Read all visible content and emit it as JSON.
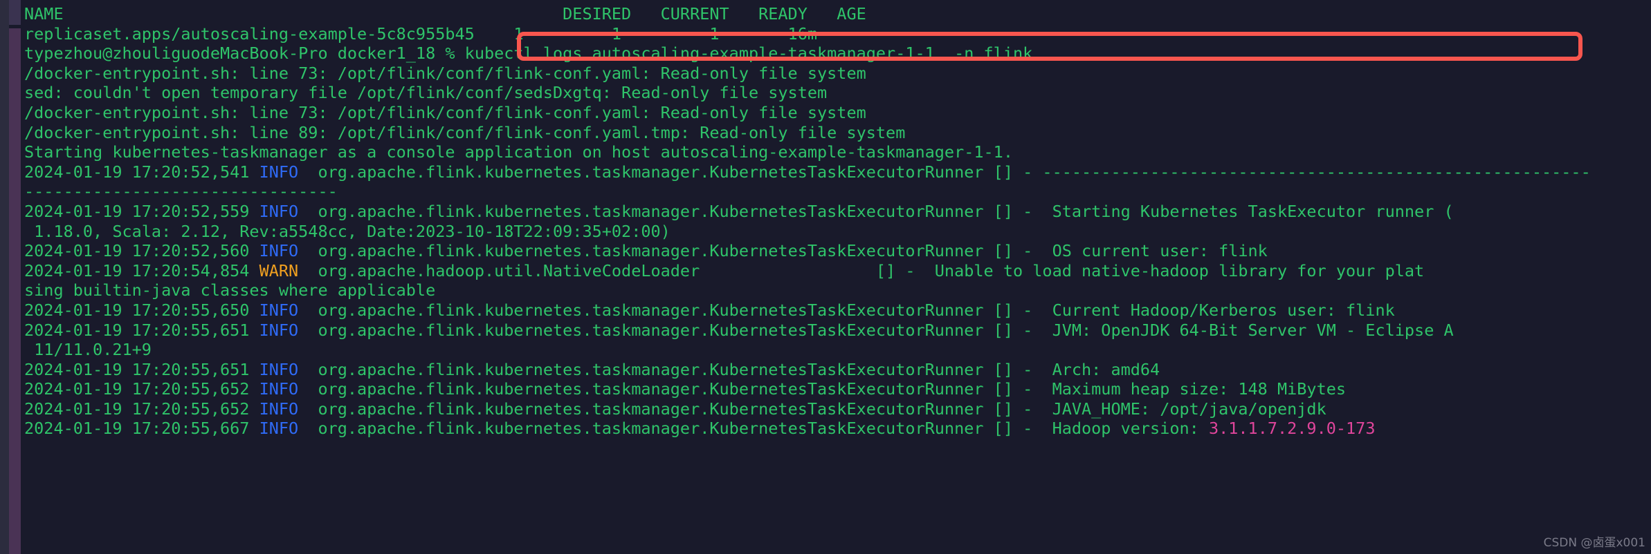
{
  "window": {
    "app": "terminal",
    "shell_prompt": "typezhou@zhouliguodeMacBook-Pro docker1_18 %"
  },
  "highlight": {
    "color": "#f8564e",
    "target_command": "kubectl logs autoscaling-example-taskmanager-1-1  -n flink"
  },
  "colors": {
    "background": "#191a2b",
    "text_green": "#2fc46a",
    "info_blue": "#2f6bf7",
    "warn_orange": "#f0a020",
    "version_pink": "#e0459b",
    "highlight_red": "#f8564e"
  },
  "table_header": {
    "name": "NAME",
    "desired": "DESIRED",
    "current": "CURRENT",
    "ready": "READY",
    "age": "AGE"
  },
  "lines": [
    {
      "id": "l00",
      "text": "NAME                                                   DESIRED   CURRENT   READY   AGE"
    },
    {
      "id": "l01",
      "text": "replicaset.apps/autoscaling-example-5c8c955b45    1         1         1       16m"
    },
    {
      "id": "l02",
      "prompt": "typezhou@zhouliguodeMacBook-Pro docker1_18 % ",
      "command": "kubectl logs autoscaling-example-taskmanager-1-1  -n flink"
    },
    {
      "id": "l03",
      "text": "/docker-entrypoint.sh: line 73: /opt/flink/conf/flink-conf.yaml: Read-only file system"
    },
    {
      "id": "l04",
      "text": "sed: couldn't open temporary file /opt/flink/conf/sedsDxgtq: Read-only file system"
    },
    {
      "id": "l05",
      "text": "/docker-entrypoint.sh: line 73: /opt/flink/conf/flink-conf.yaml: Read-only file system"
    },
    {
      "id": "l06",
      "text": "/docker-entrypoint.sh: line 89: /opt/flink/conf/flink-conf.yaml.tmp: Read-only file system"
    },
    {
      "id": "l07",
      "text": "Starting kubernetes-taskmanager as a console application on host autoscaling-example-taskmanager-1-1."
    },
    {
      "id": "l08",
      "ts": "2024-01-19 17:20:52,541",
      "level": "INFO",
      "logger": "org.apache.flink.kubernetes.taskmanager.KubernetesTaskExecutorRunner",
      "msg": "--------------------------------------------------------"
    },
    {
      "id": "l09",
      "text": "--------------------------------"
    },
    {
      "id": "l10",
      "ts": "2024-01-19 17:20:52,559",
      "level": "INFO",
      "logger": "org.apache.flink.kubernetes.taskmanager.KubernetesTaskExecutorRunner",
      "msg": " Starting Kubernetes TaskExecutor runner ("
    },
    {
      "id": "l11",
      "text": " 1.18.0, Scala: 2.12, Rev:a5548cc, Date:2023-10-18T22:09:35+02:00)"
    },
    {
      "id": "l12",
      "ts": "2024-01-19 17:20:52,560",
      "level": "INFO",
      "logger": "org.apache.flink.kubernetes.taskmanager.KubernetesTaskExecutorRunner",
      "msg": " OS current user: flink"
    },
    {
      "id": "l13",
      "ts": "2024-01-19 17:20:54,854",
      "level": "WARN",
      "logger": "org.apache.hadoop.util.NativeCodeLoader",
      "msg": " Unable to load native-hadoop library for your plat"
    },
    {
      "id": "l14",
      "text": "sing builtin-java classes where applicable"
    },
    {
      "id": "l15",
      "ts": "2024-01-19 17:20:55,650",
      "level": "INFO",
      "logger": "org.apache.flink.kubernetes.taskmanager.KubernetesTaskExecutorRunner",
      "msg": " Current Hadoop/Kerberos user: flink"
    },
    {
      "id": "l16",
      "ts": "2024-01-19 17:20:55,651",
      "level": "INFO",
      "logger": "org.apache.flink.kubernetes.taskmanager.KubernetesTaskExecutorRunner",
      "msg": " JVM: OpenJDK 64-Bit Server VM - Eclipse A"
    },
    {
      "id": "l17",
      "text": " 11/11.0.21+9"
    },
    {
      "id": "l18",
      "ts": "2024-01-19 17:20:55,651",
      "level": "INFO",
      "logger": "org.apache.flink.kubernetes.taskmanager.KubernetesTaskExecutorRunner",
      "msg": " Arch: amd64"
    },
    {
      "id": "l19",
      "ts": "2024-01-19 17:20:55,652",
      "level": "INFO",
      "logger": "org.apache.flink.kubernetes.taskmanager.KubernetesTaskExecutorRunner",
      "msg": " Maximum heap size: 148 MiBytes"
    },
    {
      "id": "l20",
      "ts": "2024-01-19 17:20:55,652",
      "level": "INFO",
      "logger": "org.apache.flink.kubernetes.taskmanager.KubernetesTaskExecutorRunner",
      "msg": " JAVA_HOME: /opt/java/openjdk"
    },
    {
      "id": "l21",
      "ts": "2024-01-19 17:20:55,667",
      "level": "INFO",
      "logger": "org.apache.flink.kubernetes.taskmanager.KubernetesTaskExecutorRunner",
      "msg": " Hadoop version: ",
      "msg_accent": "3.1.1.7.2.9.0-173"
    }
  ],
  "watermark": "CSDN @卤蛋x001"
}
